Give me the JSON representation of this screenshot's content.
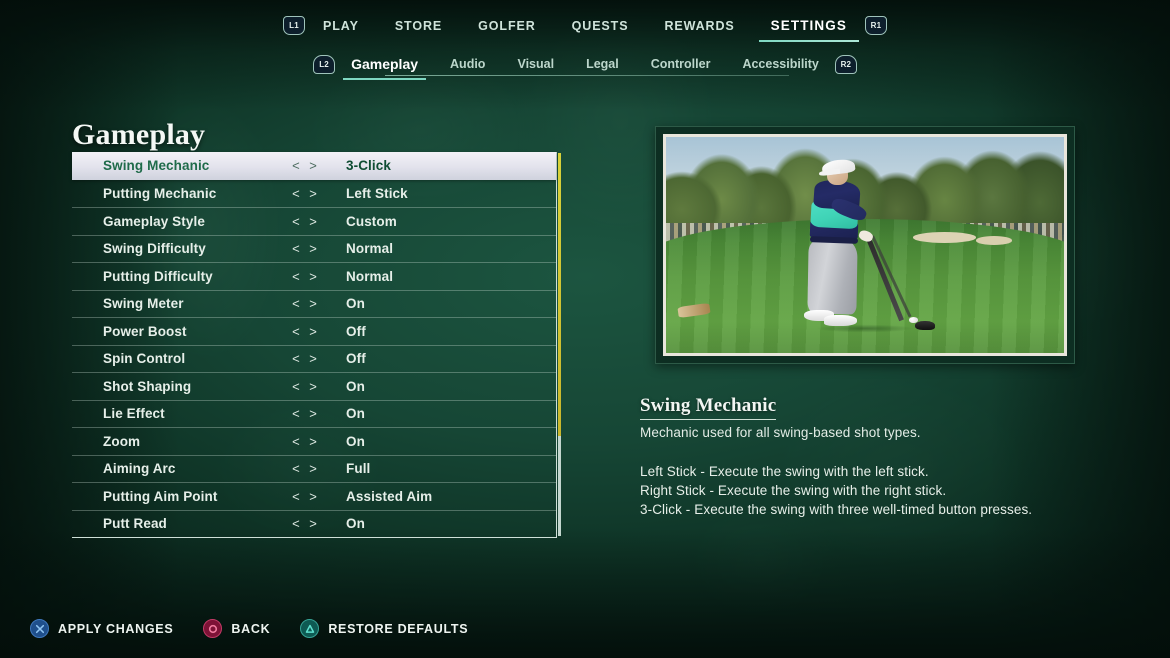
{
  "top_nav": {
    "left_bumper": "L1",
    "right_bumper": "R1",
    "items": [
      {
        "label": "PLAY",
        "active": false
      },
      {
        "label": "STORE",
        "active": false
      },
      {
        "label": "GOLFER",
        "active": false
      },
      {
        "label": "QUESTS",
        "active": false
      },
      {
        "label": "REWARDS",
        "active": false
      },
      {
        "label": "SETTINGS",
        "active": true
      }
    ]
  },
  "sub_nav": {
    "left_trigger": "L2",
    "right_trigger": "R2",
    "items": [
      {
        "label": "Gameplay",
        "active": true
      },
      {
        "label": "Audio",
        "active": false
      },
      {
        "label": "Visual",
        "active": false
      },
      {
        "label": "Legal",
        "active": false
      },
      {
        "label": "Controller",
        "active": false
      },
      {
        "label": "Accessibility",
        "active": false
      }
    ]
  },
  "page_title": "Gameplay",
  "settings_list": {
    "arrows": "< >",
    "selected_index": 0,
    "rows": [
      {
        "label": "Swing Mechanic",
        "value": "3-Click"
      },
      {
        "label": "Putting Mechanic",
        "value": "Left Stick"
      },
      {
        "label": "Gameplay Style",
        "value": "Custom"
      },
      {
        "label": "Swing Difficulty",
        "value": "Normal"
      },
      {
        "label": "Putting Difficulty",
        "value": "Normal"
      },
      {
        "label": "Swing Meter",
        "value": "On"
      },
      {
        "label": "Power Boost",
        "value": "Off"
      },
      {
        "label": "Spin Control",
        "value": "Off"
      },
      {
        "label": "Shot Shaping",
        "value": "On"
      },
      {
        "label": "Lie Effect",
        "value": "On"
      },
      {
        "label": "Zoom",
        "value": "On"
      },
      {
        "label": "Aiming Arc",
        "value": "Full"
      },
      {
        "label": "Putting Aim Point",
        "value": "Assisted Aim"
      },
      {
        "label": "Putt Read",
        "value": "On"
      }
    ]
  },
  "preview": {
    "caption": "golfer-at-address-with-driver-on-tee"
  },
  "description": {
    "title": "Swing Mechanic",
    "subtitle": "Mechanic used for all swing-based shot types.",
    "lines": [
      "Left Stick - Execute the swing with the left stick.",
      "Right Stick - Execute the swing with the right stick.",
      "3-Click - Execute the swing with three well-timed button presses."
    ]
  },
  "footer_hints": [
    {
      "button": "cross",
      "label": "APPLY CHANGES"
    },
    {
      "button": "circle",
      "label": "BACK"
    },
    {
      "button": "triangle",
      "label": "RESTORE DEFAULTS"
    }
  ],
  "colors": {
    "background_green": "#164635",
    "accent_teal": "#7fd8c2",
    "selected_row_bg": "#e8e8f0",
    "selected_row_text": "#1f6b4a",
    "scrollbar_thumb": "#d8d23a",
    "scrollbar_track": "#c3d6ce"
  }
}
